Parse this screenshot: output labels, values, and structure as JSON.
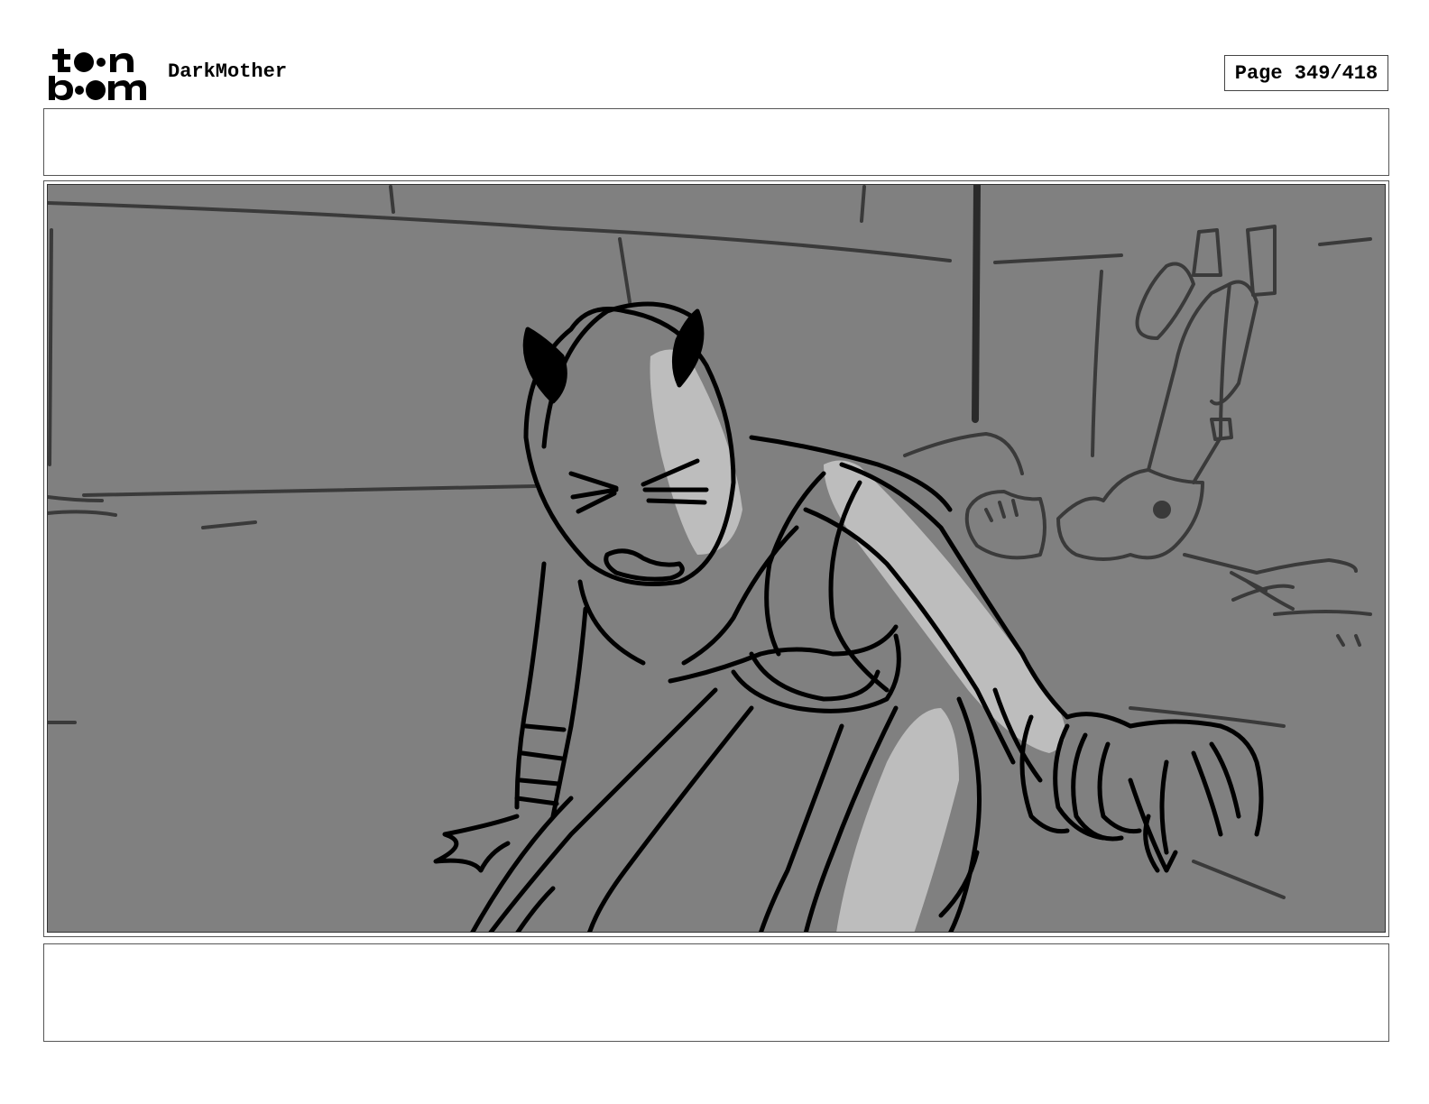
{
  "header": {
    "logo_top": "to•n",
    "logo_bottom": "b••m",
    "project_title": "DarkMother",
    "page_label": "Page 349/418"
  },
  "panel": {
    "action_notes": "",
    "dialogue_notes": ""
  },
  "colors": {
    "frame_background": "#808080",
    "highlight": "#bdbdbd",
    "line": "#000000"
  }
}
